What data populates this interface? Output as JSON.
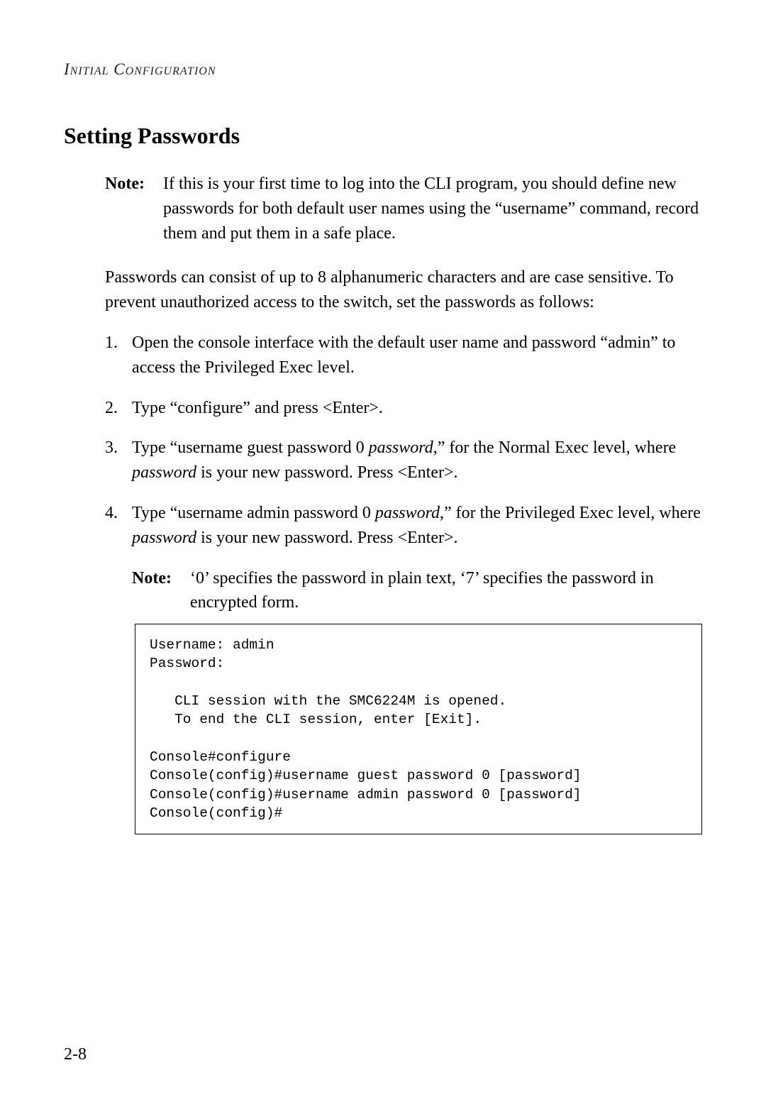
{
  "chapterHeader": "Initial Configuration",
  "sectionTitle": "Setting Passwords",
  "note1": {
    "label": "Note:",
    "text": "If this is your first time to log into the CLI program, you should define new passwords for both default user names using the “username” command, record them and put them in a safe place."
  },
  "intro": "Passwords can consist of up to 8 alphanumeric characters and are case sensitive. To prevent unauthorized access to the switch, set the passwords as follows:",
  "steps": [
    {
      "num": "1.",
      "segments": [
        {
          "t": "Open the console interface with the default user name and password “admin” to access the Privileged Exec level."
        }
      ]
    },
    {
      "num": "2.",
      "segments": [
        {
          "t": "Type “configure” and press <Enter>."
        }
      ]
    },
    {
      "num": "3.",
      "segments": [
        {
          "t": "Type “username guest password 0 "
        },
        {
          "t": "password",
          "i": true
        },
        {
          "t": ",” for the Normal Exec level, where "
        },
        {
          "t": "password",
          "i": true
        },
        {
          "t": " is your new password. Press <Enter>."
        }
      ]
    },
    {
      "num": "4.",
      "segments": [
        {
          "t": "Type “username admin password 0 "
        },
        {
          "t": "password",
          "i": true
        },
        {
          "t": ",” for the Privileged Exec level, where "
        },
        {
          "t": "password",
          "i": true
        },
        {
          "t": " is your new password. Press <Enter>."
        }
      ]
    }
  ],
  "note2": {
    "label": "Note:",
    "text": "‘0’ specifies the password in plain text, ‘7’ specifies the password in encrypted form."
  },
  "code": "Username: admin\nPassword:\n\n   CLI session with the SMC6224M is opened.\n   To end the CLI session, enter [Exit].\n\nConsole#configure\nConsole(config)#username guest password 0 [password]\nConsole(config)#username admin password 0 [password]\nConsole(config)#",
  "pageNumber": "2-8"
}
